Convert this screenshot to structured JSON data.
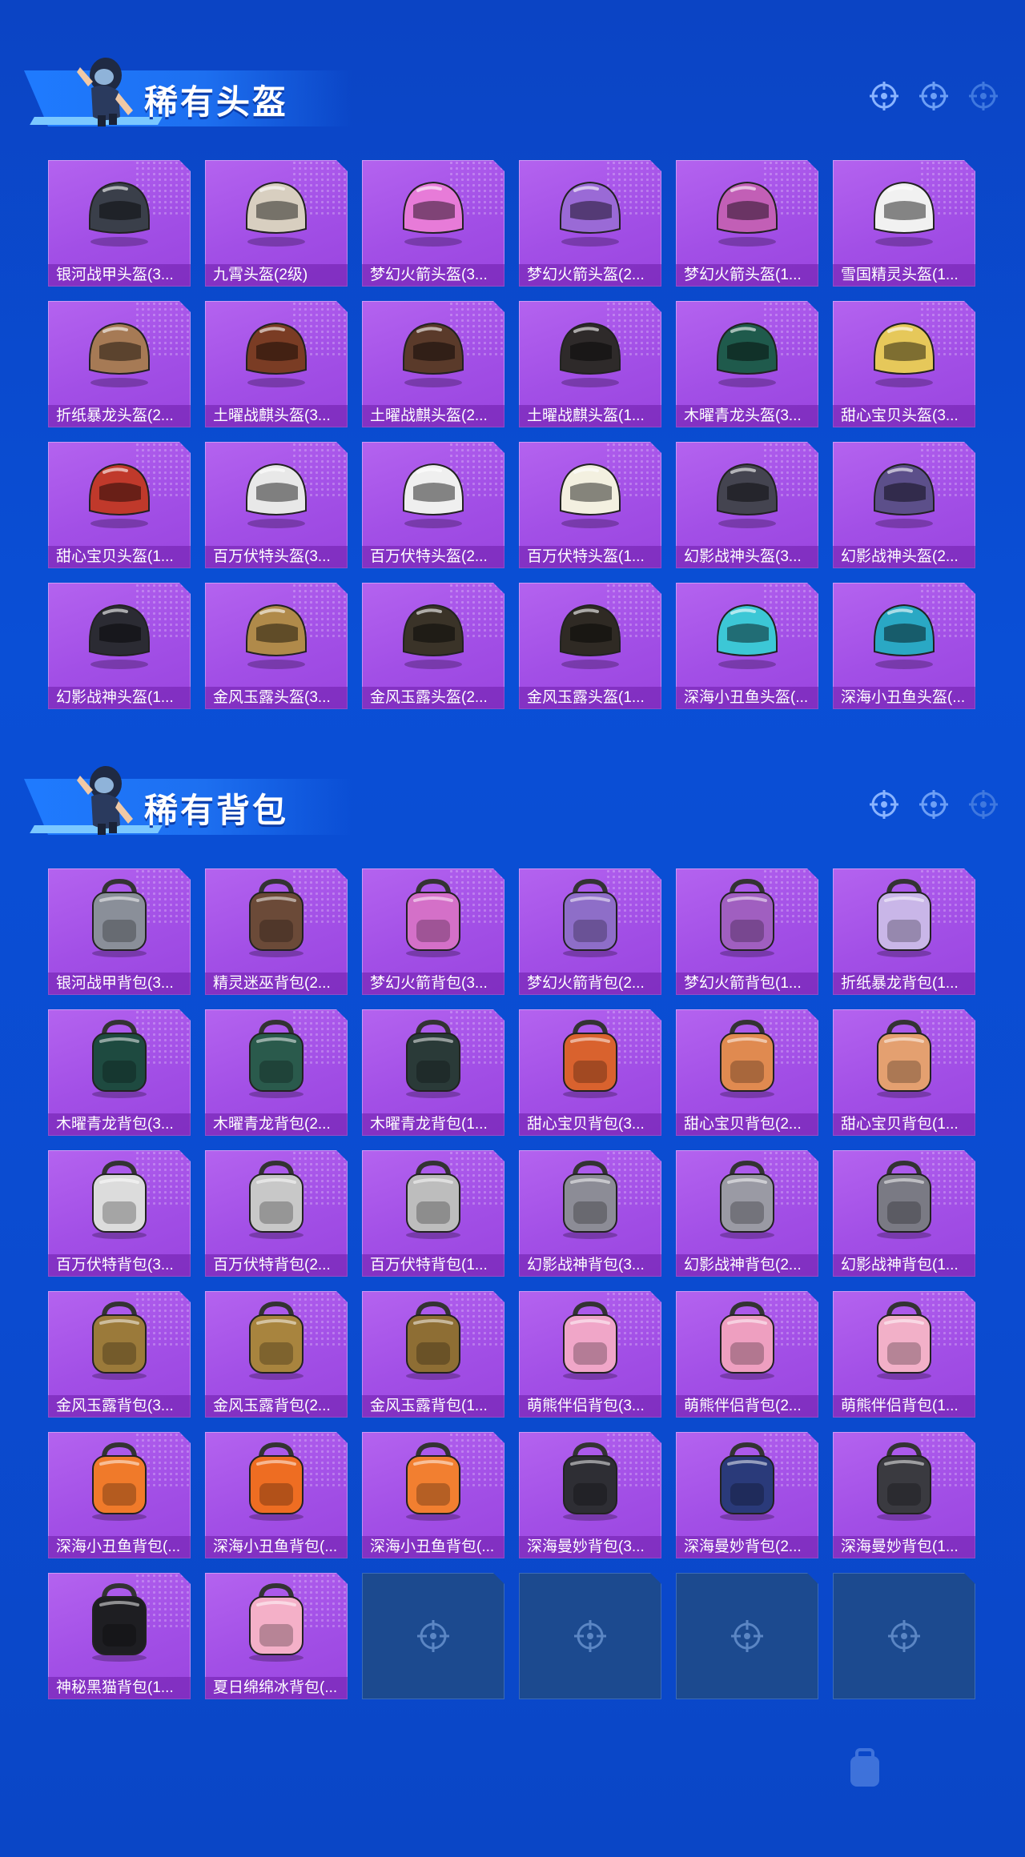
{
  "sections": [
    {
      "title": "稀有头盔",
      "kind": "helmet",
      "items": [
        {
          "label": "银河战甲头盔(3...",
          "color": "#3a3f4a"
        },
        {
          "label": "九霄头盔(2级)",
          "color": "#d8cfc0"
        },
        {
          "label": "梦幻火箭头盔(3...",
          "color": "#e77bd8"
        },
        {
          "label": "梦幻火箭头盔(2...",
          "color": "#9a6ad6"
        },
        {
          "label": "梦幻火箭头盔(1...",
          "color": "#c25fb6"
        },
        {
          "label": "雪国精灵头盔(1...",
          "color": "#f1f1f1"
        },
        {
          "label": "折纸暴龙头盔(2...",
          "color": "#a67a55"
        },
        {
          "label": "土曜战麒头盔(3...",
          "color": "#7a3c24"
        },
        {
          "label": "土曜战麒头盔(2...",
          "color": "#5a3a2a"
        },
        {
          "label": "土曜战麒头盔(1...",
          "color": "#2e2a2a"
        },
        {
          "label": "木曜青龙头盔(3...",
          "color": "#1f5a4c"
        },
        {
          "label": "甜心宝贝头盔(3...",
          "color": "#e6c85a"
        },
        {
          "label": "甜心宝贝头盔(1...",
          "color": "#c0392b"
        },
        {
          "label": "百万伏特头盔(3...",
          "color": "#e8e8e8"
        },
        {
          "label": "百万伏特头盔(2...",
          "color": "#efefef"
        },
        {
          "label": "百万伏特头盔(1...",
          "color": "#f3f0e0"
        },
        {
          "label": "幻影战神头盔(3...",
          "color": "#444450"
        },
        {
          "label": "幻影战神头盔(2...",
          "color": "#5c4f8a"
        },
        {
          "label": "幻影战神头盔(1...",
          "color": "#2b2b33"
        },
        {
          "label": "金风玉露头盔(3...",
          "color": "#b08a4a"
        },
        {
          "label": "金风玉露头盔(2...",
          "color": "#3a3328"
        },
        {
          "label": "金风玉露头盔(1...",
          "color": "#2f2a24"
        },
        {
          "label": "深海小丑鱼头盔(...",
          "color": "#3cc7d6"
        },
        {
          "label": "深海小丑鱼头盔(...",
          "color": "#2aa8c4"
        }
      ]
    },
    {
      "title": "稀有背包",
      "kind": "backpack",
      "items": [
        {
          "label": "银河战甲背包(3...",
          "color": "#8a8f99"
        },
        {
          "label": "精灵迷巫背包(2...",
          "color": "#6b4a38"
        },
        {
          "label": "梦幻火箭背包(3...",
          "color": "#d470c8"
        },
        {
          "label": "梦幻火箭背包(2...",
          "color": "#8e6ec8"
        },
        {
          "label": "梦幻火箭背包(1...",
          "color": "#a05fc0"
        },
        {
          "label": "折纸暴龙背包(1...",
          "color": "#c9b6e8"
        },
        {
          "label": "木曜青龙背包(3...",
          "color": "#1e4a40"
        },
        {
          "label": "木曜青龙背包(2...",
          "color": "#2a5a4c"
        },
        {
          "label": "木曜青龙背包(1...",
          "color": "#2a3a38"
        },
        {
          "label": "甜心宝贝背包(3...",
          "color": "#d9622e"
        },
        {
          "label": "甜心宝贝背包(2...",
          "color": "#e08a50"
        },
        {
          "label": "甜心宝贝背包(1...",
          "color": "#e4a070"
        },
        {
          "label": "百万伏特背包(3...",
          "color": "#dcdcdc"
        },
        {
          "label": "百万伏特背包(2...",
          "color": "#c8c8c8"
        },
        {
          "label": "百万伏特背包(1...",
          "color": "#bdbdbd"
        },
        {
          "label": "幻影战神背包(3...",
          "color": "#8c8c96"
        },
        {
          "label": "幻影战神背包(2...",
          "color": "#9a9aa4"
        },
        {
          "label": "幻影战神背包(1...",
          "color": "#7a7a84"
        },
        {
          "label": "金风玉露背包(3...",
          "color": "#9b7a3a"
        },
        {
          "label": "金风玉露背包(2...",
          "color": "#a8843e"
        },
        {
          "label": "金风玉露背包(1...",
          "color": "#8e6e34"
        },
        {
          "label": "萌熊伴侣背包(3...",
          "color": "#f0a6c8"
        },
        {
          "label": "萌熊伴侣背包(2...",
          "color": "#ee9fc0"
        },
        {
          "label": "萌熊伴侣背包(1...",
          "color": "#f2b0c8"
        },
        {
          "label": "深海小丑鱼背包(...",
          "color": "#f07a2a"
        },
        {
          "label": "深海小丑鱼背包(...",
          "color": "#ee6d22"
        },
        {
          "label": "深海小丑鱼背包(...",
          "color": "#f27f30"
        },
        {
          "label": "深海曼妙背包(3...",
          "color": "#2e2e34"
        },
        {
          "label": "深海曼妙背包(2...",
          "color": "#2a3a7a"
        },
        {
          "label": "深海曼妙背包(1...",
          "color": "#3a3a40"
        },
        {
          "label": "神秘黑猫背包(1...",
          "color": "#1e1e22"
        },
        {
          "label": "夏日绵绵冰背包(...",
          "color": "#f4b0c8"
        }
      ],
      "empty_slots": 4
    }
  ]
}
